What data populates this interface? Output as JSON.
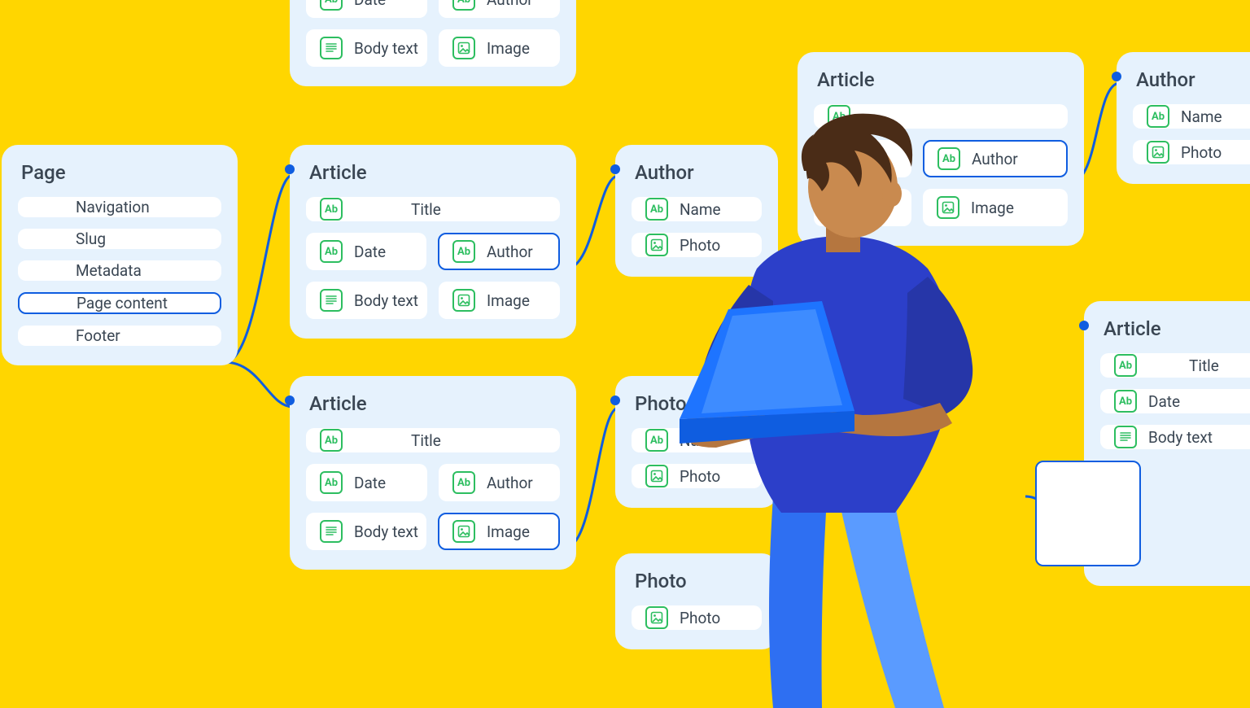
{
  "topArticle": {
    "title": "",
    "fields": [
      {
        "icon": "ab",
        "label": "Date"
      },
      {
        "icon": "ab",
        "label": "Author"
      },
      {
        "icon": "lines",
        "label": "Body text"
      },
      {
        "icon": "image",
        "label": "Image"
      }
    ]
  },
  "page": {
    "title": "Page",
    "fields": [
      {
        "label": "Navigation"
      },
      {
        "label": "Slug"
      },
      {
        "label": "Metadata"
      },
      {
        "label": "Page content",
        "selected": true
      },
      {
        "label": "Footer"
      }
    ]
  },
  "article1": {
    "title": "Article",
    "rows": [
      [
        {
          "icon": "ab",
          "label": "Title",
          "wide": true
        }
      ],
      [
        {
          "icon": "ab",
          "label": "Date"
        },
        {
          "icon": "ab",
          "label": "Author",
          "selected": true
        }
      ],
      [
        {
          "icon": "lines",
          "label": "Body text"
        },
        {
          "icon": "image",
          "label": "Image"
        }
      ]
    ]
  },
  "article2": {
    "title": "Article",
    "rows": [
      [
        {
          "icon": "ab",
          "label": "Title",
          "wide": true
        }
      ],
      [
        {
          "icon": "ab",
          "label": "Date"
        },
        {
          "icon": "ab",
          "label": "Author"
        }
      ],
      [
        {
          "icon": "lines",
          "label": "Body text"
        },
        {
          "icon": "image",
          "label": "Image",
          "selected": true
        }
      ]
    ]
  },
  "author": {
    "title": "Author",
    "fields": [
      {
        "icon": "ab",
        "label": "Name"
      },
      {
        "icon": "image",
        "label": "Photo"
      }
    ]
  },
  "photo": {
    "title": "Photo",
    "fields": [
      {
        "icon": "ab",
        "label": "Name"
      },
      {
        "icon": "image",
        "label": "Photo"
      }
    ]
  },
  "photo2": {
    "title": "Photo",
    "fields": [
      {
        "icon": "image",
        "label": "Photo"
      }
    ]
  },
  "articleBg": {
    "title": "Article",
    "rows": [
      [
        {
          "icon": "ab",
          "label": ""
        }
      ],
      [
        {
          "icon": "ab",
          "label": "Author",
          "selected": true
        }
      ],
      [
        {
          "icon": "image",
          "label": "Image"
        }
      ]
    ]
  },
  "authorRight": {
    "title": "Author",
    "fields": [
      {
        "icon": "ab",
        "label": "Name"
      },
      {
        "icon": "image",
        "label": "Photo"
      }
    ]
  },
  "articleRight": {
    "title": "Article",
    "fields": [
      {
        "icon": "ab",
        "label": "Title"
      },
      {
        "icon": "ab",
        "label": "Date"
      },
      {
        "icon": "lines",
        "label": "Body text"
      },
      {
        "label": "",
        "selected": true,
        "empty": true
      }
    ]
  },
  "icons": {
    "ab": "Ab"
  }
}
